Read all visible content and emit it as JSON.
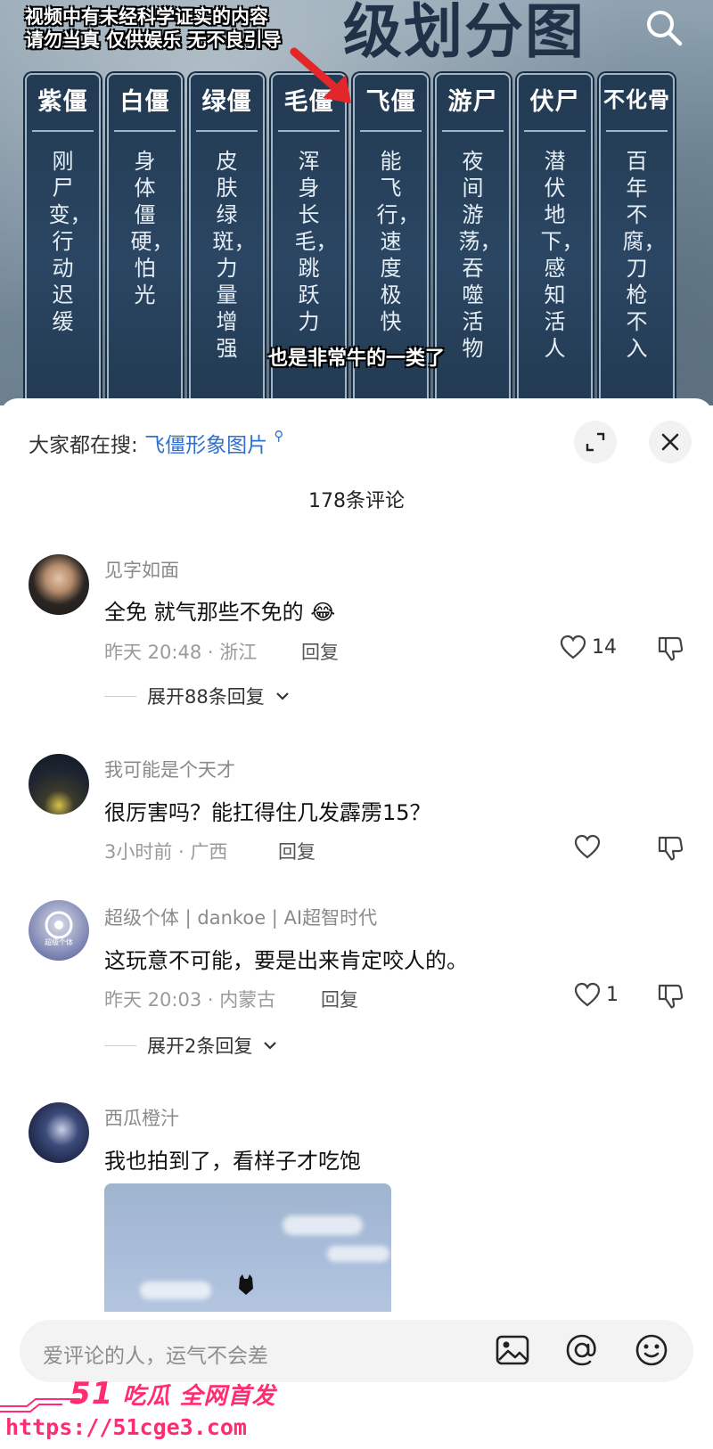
{
  "video": {
    "title_partial": "级划分图",
    "disclaimer_line1": "视频中有未经科学证实的内容",
    "disclaimer_line2": "请勿当真 仅供娱乐 无不良引导",
    "subtitle": "也是非常牛的一类了",
    "columns": [
      {
        "head": "紫僵",
        "body": "刚尸变，行动迟缓"
      },
      {
        "head": "白僵",
        "body": "身体僵硬，怕光"
      },
      {
        "head": "绿僵",
        "body": "皮肤绿斑，力量增强"
      },
      {
        "head": "毛僵",
        "body": "浑身长毛，跳跃力"
      },
      {
        "head": "飞僵",
        "body": "能飞行，速度极快"
      },
      {
        "head": "游尸",
        "body": "夜间游荡，吞噬活物"
      },
      {
        "head": "伏尸",
        "body": "潜伏地下，感知活人"
      },
      {
        "head": "不化骨",
        "body": "百年不腐，刀枪不入"
      }
    ]
  },
  "sheet": {
    "search_prefix": "大家都在搜:",
    "search_term": "飞僵形象图片",
    "search_glyph": "⚲",
    "comment_count": "178条评论"
  },
  "comments": [
    {
      "name": "见字如面",
      "text": "全免 就气那些不免的 😂",
      "meta": "昨天 20:48 · 浙江",
      "reply": "回复",
      "likes": "14",
      "expand": "展开88条回复"
    },
    {
      "name": "我可能是个天才",
      "text": "很厉害吗？能扛得住几发霹雳15？",
      "meta": "3小时前 · 广西",
      "reply": "回复",
      "likes": ""
    },
    {
      "name": "超级个体 | dankoe | AI超智时代",
      "avatar_text": "超级个体",
      "text": "这玩意不可能，要是出来肯定咬人的。",
      "meta": "昨天 20:03 · 内蒙古",
      "reply": "回复",
      "likes": "1",
      "expand": "展开2条回复"
    },
    {
      "name": "西瓜橙汁",
      "text": "我也拍到了，看样子才吃饱"
    }
  ],
  "input": {
    "placeholder": "爱评论的人，运气不会差"
  },
  "watermark": {
    "logo_num": "51",
    "logo_text": "吃瓜 全网首发",
    "url": "https://51cge3.com"
  },
  "colors": {
    "accent_link": "#2f6fd0",
    "watermark": "#ff2d6f",
    "arrow": "#e3262a"
  },
  "icons": {
    "search": "search-icon",
    "expand": "expand-icon",
    "close": "close-icon",
    "like": "heart-icon",
    "dislike": "thumbs-down-icon",
    "image": "image-icon",
    "at": "at-icon",
    "emoji": "emoji-icon"
  }
}
